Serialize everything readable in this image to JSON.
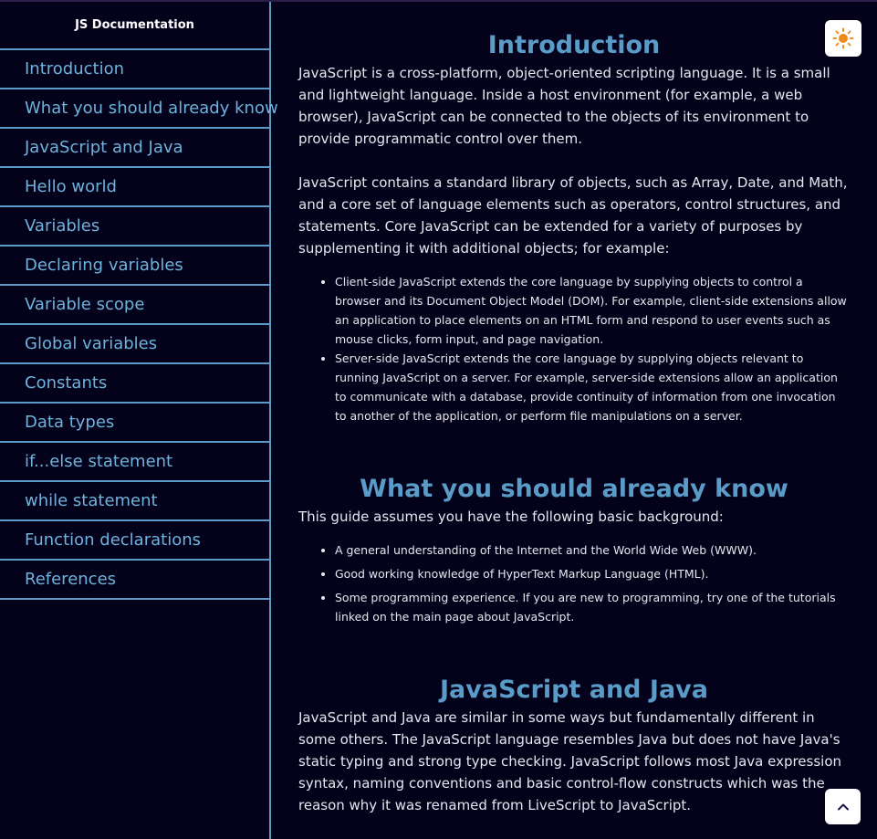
{
  "sidebar": {
    "title": "JS Documentation",
    "items": [
      {
        "label": "Introduction"
      },
      {
        "label": "What you should already know"
      },
      {
        "label": "JavaScript and Java"
      },
      {
        "label": "Hello world"
      },
      {
        "label": "Variables"
      },
      {
        "label": "Declaring variables"
      },
      {
        "label": "Variable scope"
      },
      {
        "label": "Global variables"
      },
      {
        "label": "Constants"
      },
      {
        "label": "Data types"
      },
      {
        "label": "if...else statement"
      },
      {
        "label": "while statement"
      },
      {
        "label": "Function declarations"
      },
      {
        "label": "References"
      }
    ]
  },
  "main": {
    "intro": {
      "title": "Introduction",
      "p1": "JavaScript is a cross-platform, object-oriented scripting language. It is a small and lightweight language. Inside a host environment (for example, a web browser), JavaScript can be connected to the objects of its environment to provide programmatic control over them.",
      "p2": "JavaScript contains a standard library of objects, such as Array, Date, and Math, and a core set of language elements such as operators, control structures, and statements. Core JavaScript can be extended for a variety of purposes by supplementing it with additional objects; for example:",
      "bullets": [
        "Client-side JavaScript extends the core language by supplying objects to control a browser and its Document Object Model (DOM). For example, client-side extensions allow an application to place elements on an HTML form and respond to user events such as mouse clicks, form input, and page navigation.",
        "Server-side JavaScript extends the core language by supplying objects relevant to running JavaScript on a server. For example, server-side extensions allow an application to communicate with a database, provide continuity of information from one invocation to another of the application, or perform file manipulations on a server."
      ]
    },
    "know": {
      "title": "What you should already know",
      "p1": "This guide assumes you have the following basic background:",
      "bullets": [
        "A general understanding of the Internet and the World Wide Web (WWW).",
        "Good working knowledge of HyperText Markup Language (HTML).",
        "Some programming experience. If you are new to programming, try one of the tutorials linked on the main page about JavaScript."
      ]
    },
    "java": {
      "title": "JavaScript and Java",
      "p1": "JavaScript and Java are similar in some ways but fundamentally different in some others. The JavaScript language resembles Java but does not have Java's static typing and strong type checking. JavaScript follows most Java expression syntax, naming conventions and basic control-flow constructs which was the reason why it was renamed from LiveScript to JavaScript."
    }
  },
  "icons": {
    "theme_toggle": "sun-icon",
    "scroll_top": "chevron-up-icon"
  },
  "colors": {
    "background": "#03021a",
    "accent": "#5a9bc7",
    "sun": "#f08a1c"
  }
}
